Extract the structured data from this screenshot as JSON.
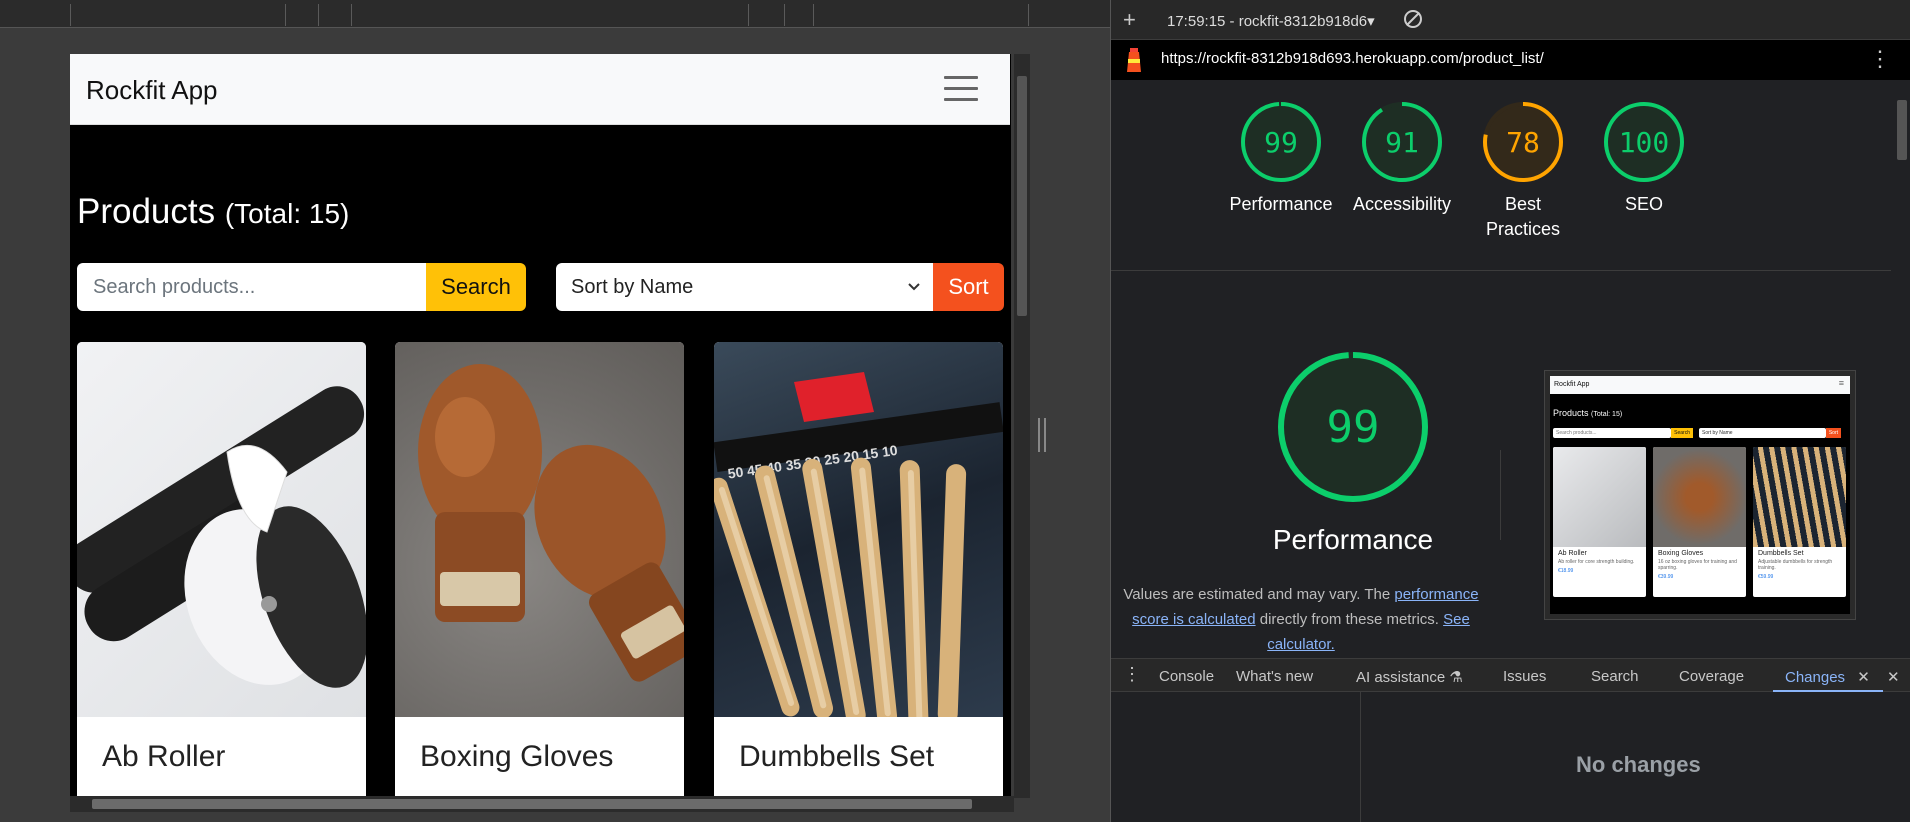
{
  "viewport": {
    "navbar": {
      "brand": "Rockfit App"
    },
    "heading": {
      "title": "Products",
      "total": "(Total: 15)"
    },
    "search": {
      "placeholder": "Search products...",
      "button": "Search"
    },
    "sort": {
      "selected": "Sort by Name",
      "button": "Sort"
    },
    "products": [
      {
        "name": "Ab Roller",
        "icon": "ab-roller-image"
      },
      {
        "name": "Boxing Gloves",
        "icon": "boxing-gloves-image"
      },
      {
        "name": "Dumbbells Set",
        "icon": "dumbbells-image"
      }
    ],
    "colors": {
      "search_button": "#ffc107",
      "sort_button": "#f4511e",
      "navbar_bg": "#f8f9fa",
      "page_bg": "#000000"
    }
  },
  "devtools": {
    "report_select": "17:59:15 - rockfit-8312b918d6⁠⁠▾",
    "url": "https://rockfit-8312b918d693.herokuapp.com/product_list/",
    "scores": [
      {
        "value": "99",
        "label": "Performance",
        "color": "#0cce6b",
        "fraction": 0.99
      },
      {
        "value": "91",
        "label": "Accessibility",
        "color": "#0cce6b",
        "fraction": 0.91
      },
      {
        "value": "78",
        "label": "Best Practices",
        "color": "#ffa400",
        "fraction": 0.78
      },
      {
        "value": "100",
        "label": "SEO",
        "color": "#0cce6b",
        "fraction": 1.0
      }
    ],
    "performance": {
      "score": "99",
      "fraction": 0.99,
      "title": "Performance",
      "desc_prefix": "Values are estimated and may vary. The ",
      "desc_link1": "performance score is calculated",
      "desc_middle": " directly from these metrics. ",
      "desc_link2": "See calculator."
    },
    "thumbnail": {
      "brand": "Rockfit App",
      "title": "Products",
      "total": "(Total: 15)",
      "search_placeholder": "Search products...",
      "search_button": "Search",
      "sort_selected": "Sort by Name",
      "sort_button": "Sort",
      "cards": [
        {
          "name": "Ab Roller",
          "desc": "Ab roller for core strength building.",
          "price": "€18.99"
        },
        {
          "name": "Boxing Gloves",
          "desc": "16 oz boxing gloves for training and sparring.",
          "price": "€39.99"
        },
        {
          "name": "Dumbbells Set",
          "desc": "Adjustable dumbbells for strength training.",
          "price": "€59.99"
        }
      ]
    },
    "drawer_tabs": [
      "Console",
      "What's new",
      "AI assistance",
      "Issues",
      "Search",
      "Coverage",
      "Changes"
    ],
    "active_tab": "Changes",
    "drawer_message": "No changes"
  }
}
